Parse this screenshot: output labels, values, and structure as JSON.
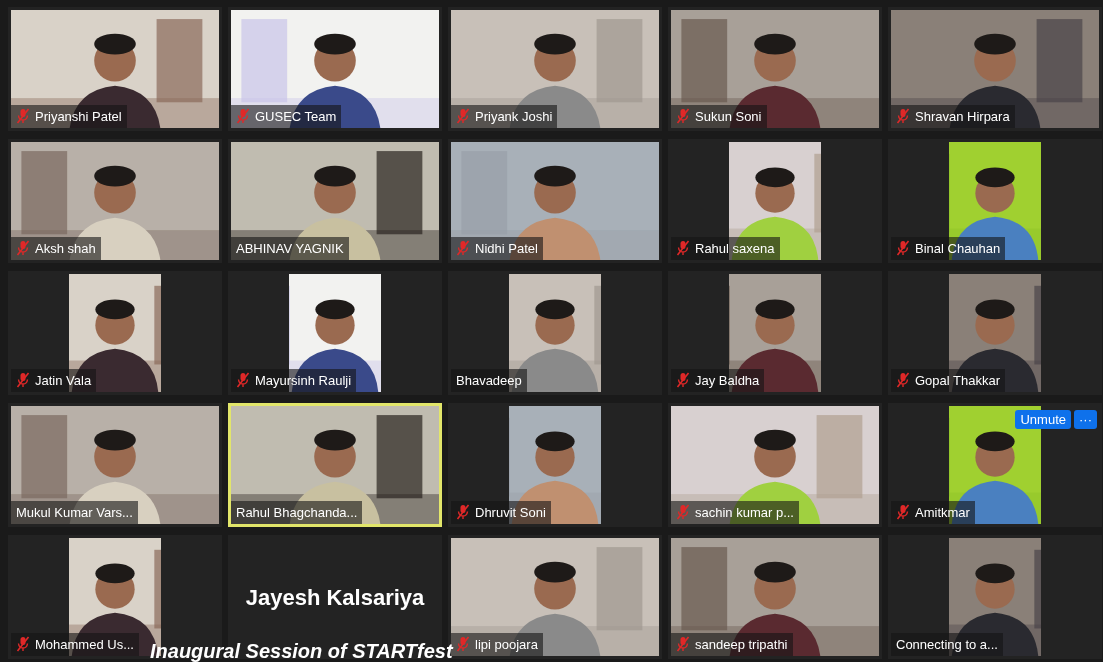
{
  "tiles": [
    {
      "name": "Priyanshi Patel",
      "muted": true,
      "kind": "video",
      "active_speaker": false
    },
    {
      "name": "GUSEC Team",
      "muted": true,
      "kind": "video",
      "active_speaker": false
    },
    {
      "name": "Priyank Joshi",
      "muted": true,
      "kind": "video",
      "active_speaker": false
    },
    {
      "name": "Sukun Soni",
      "muted": true,
      "kind": "video",
      "active_speaker": false
    },
    {
      "name": "Shravan Hirpara",
      "muted": true,
      "kind": "video",
      "active_speaker": false
    },
    {
      "name": "Aksh shah",
      "muted": true,
      "kind": "video",
      "active_speaker": false
    },
    {
      "name": "ABHINAV YAGNIK",
      "muted": false,
      "kind": "video",
      "active_speaker": false
    },
    {
      "name": "Nidhi Patel",
      "muted": true,
      "kind": "video",
      "active_speaker": false
    },
    {
      "name": "Rahul saxena",
      "muted": true,
      "kind": "portrait",
      "active_speaker": false
    },
    {
      "name": "Binal Chauhan",
      "muted": true,
      "kind": "portrait",
      "active_speaker": false
    },
    {
      "name": "Jatin Vala",
      "muted": true,
      "kind": "portrait",
      "active_speaker": false
    },
    {
      "name": "Mayursinh Raulji",
      "muted": true,
      "kind": "portrait",
      "active_speaker": false
    },
    {
      "name": "Bhavadeep",
      "muted": false,
      "kind": "portrait",
      "active_speaker": false
    },
    {
      "name": "Jay Baldha",
      "muted": true,
      "kind": "portrait",
      "active_speaker": false
    },
    {
      "name": "Gopal Thakkar",
      "muted": true,
      "kind": "portrait",
      "active_speaker": false
    },
    {
      "name": "Mukul Kumar Vars...",
      "muted": false,
      "kind": "video",
      "active_speaker": false
    },
    {
      "name": "Rahul Bhagchanda...",
      "muted": false,
      "kind": "video",
      "active_speaker": true
    },
    {
      "name": "Dhruvit Soni",
      "muted": true,
      "kind": "portrait",
      "active_speaker": false
    },
    {
      "name": "sachin kumar p...",
      "muted": true,
      "kind": "video",
      "active_speaker": false
    },
    {
      "name": "Amitkmar",
      "muted": true,
      "kind": "portrait",
      "active_speaker": false,
      "controls": [
        {
          "label": "Unmute"
        },
        {
          "label": "···"
        }
      ]
    },
    {
      "name": "Mohammed Us...",
      "muted": true,
      "kind": "portrait",
      "active_speaker": false
    },
    {
      "name": "Jayesh Kalsariya",
      "kind": "name_only",
      "active_speaker": false
    },
    {
      "name": "lipi poojara",
      "muted": true,
      "kind": "video",
      "active_speaker": false
    },
    {
      "name": "sandeep tripathi",
      "muted": true,
      "kind": "video",
      "active_speaker": false
    },
    {
      "name": "Connecting to a...",
      "muted": false,
      "kind": "portrait",
      "active_speaker": false
    }
  ],
  "caption": "Inaugural Session of STARTfest"
}
